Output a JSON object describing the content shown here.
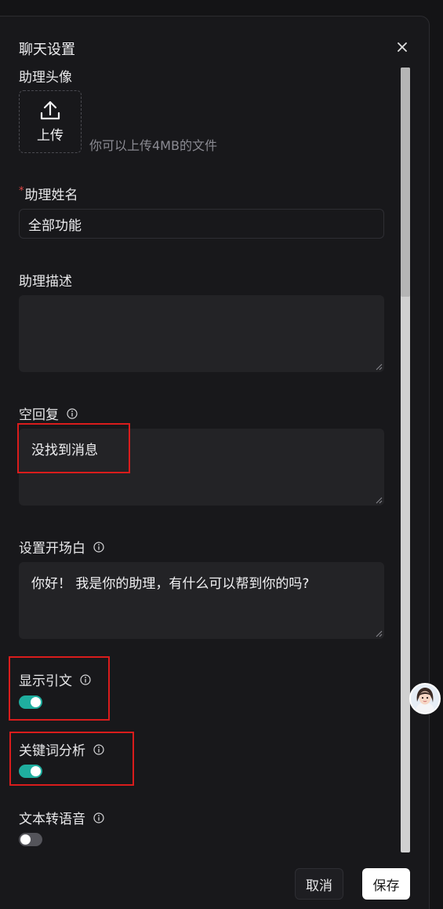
{
  "dialog": {
    "title": "聊天设置",
    "close_icon": "close-icon"
  },
  "avatar_section": {
    "label": "助理头像",
    "upload_label": "上传",
    "hint": "你可以上传4MB的文件"
  },
  "name_section": {
    "required_mark": "*",
    "label": "助理姓名",
    "value": "全部功能"
  },
  "description_section": {
    "label": "助理描述",
    "value": ""
  },
  "empty_reply_section": {
    "label": "空回复",
    "value": "没找到消息"
  },
  "opening_section": {
    "label": "设置开场白",
    "value": "你好！ 我是你的助理，有什么可以帮到你的吗?"
  },
  "toggles": [
    {
      "label": "显示引文",
      "enabled": true
    },
    {
      "label": "关键词分析",
      "enabled": true
    },
    {
      "label": "文本转语音",
      "enabled": false
    }
  ],
  "footer": {
    "cancel_label": "取消",
    "save_label": "保存"
  },
  "colors": {
    "toggle_on": "#1fae9f",
    "toggle_off": "#54545a",
    "annotation_red": "#d91c1c"
  }
}
